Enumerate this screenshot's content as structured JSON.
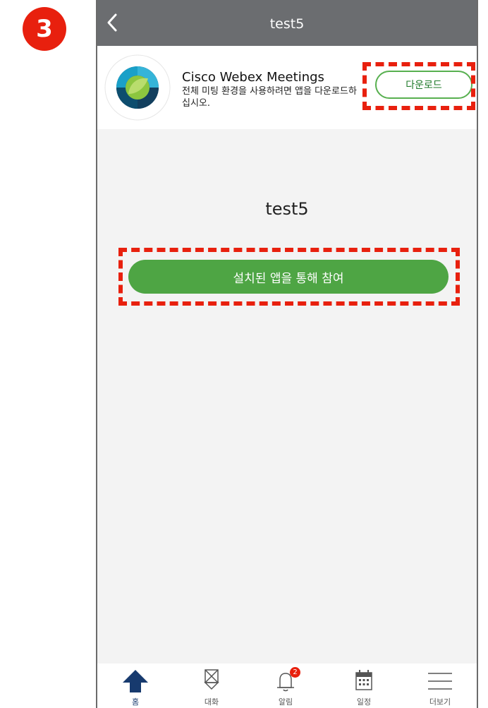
{
  "step_number": "3",
  "topbar": {
    "title": "test5"
  },
  "banner": {
    "app_name": "Cisco Webex Meetings",
    "description": "전체 미팅 환경을 사용하려면 앱을 다운로드하십시오.",
    "download_label": "다운로드"
  },
  "meeting": {
    "title": "test5",
    "join_label": "설치된 앱을 통해 참여"
  },
  "tabs": [
    {
      "label": "홈",
      "icon": "home-icon"
    },
    {
      "label": "대화",
      "icon": "chat-icon"
    },
    {
      "label": "알림",
      "icon": "bell-icon",
      "badge": "2"
    },
    {
      "label": "일정",
      "icon": "calendar-icon"
    },
    {
      "label": "더보기",
      "icon": "menu-icon"
    }
  ],
  "colors": {
    "accent_green": "#4ea544",
    "highlight_red": "#e8200e",
    "topbar_gray": "#6b6d70",
    "home_blue": "#173a6e"
  }
}
